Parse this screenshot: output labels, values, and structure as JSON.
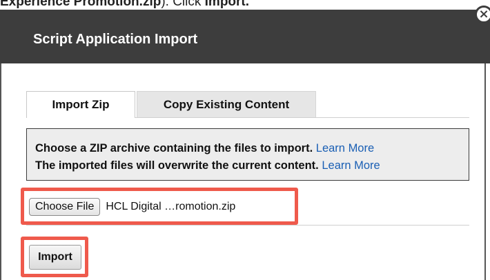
{
  "doc_instruction": {
    "filename_bold": "Experience Promotion.zip",
    "middle_text": "). Click ",
    "action_bold": "Import."
  },
  "dialog": {
    "title": "Script Application Import",
    "close_glyph": "×"
  },
  "tabs": [
    {
      "label": "Import Zip",
      "active": true
    },
    {
      "label": "Copy Existing Content",
      "active": false
    }
  ],
  "info": {
    "line1_text": "Choose a ZIP archive containing the files to import.",
    "line1_link": "Learn More",
    "line2_text": "The imported files will overwrite the current content.",
    "line2_link": "Learn More"
  },
  "file_input": {
    "button_label": "Choose File",
    "selected_file": "HCL Digital …romotion.zip"
  },
  "import_button": {
    "label": "Import"
  },
  "colors": {
    "header_bg": "#3d3d3d",
    "highlight": "#ef5a4c",
    "link": "#1a5fb4"
  }
}
